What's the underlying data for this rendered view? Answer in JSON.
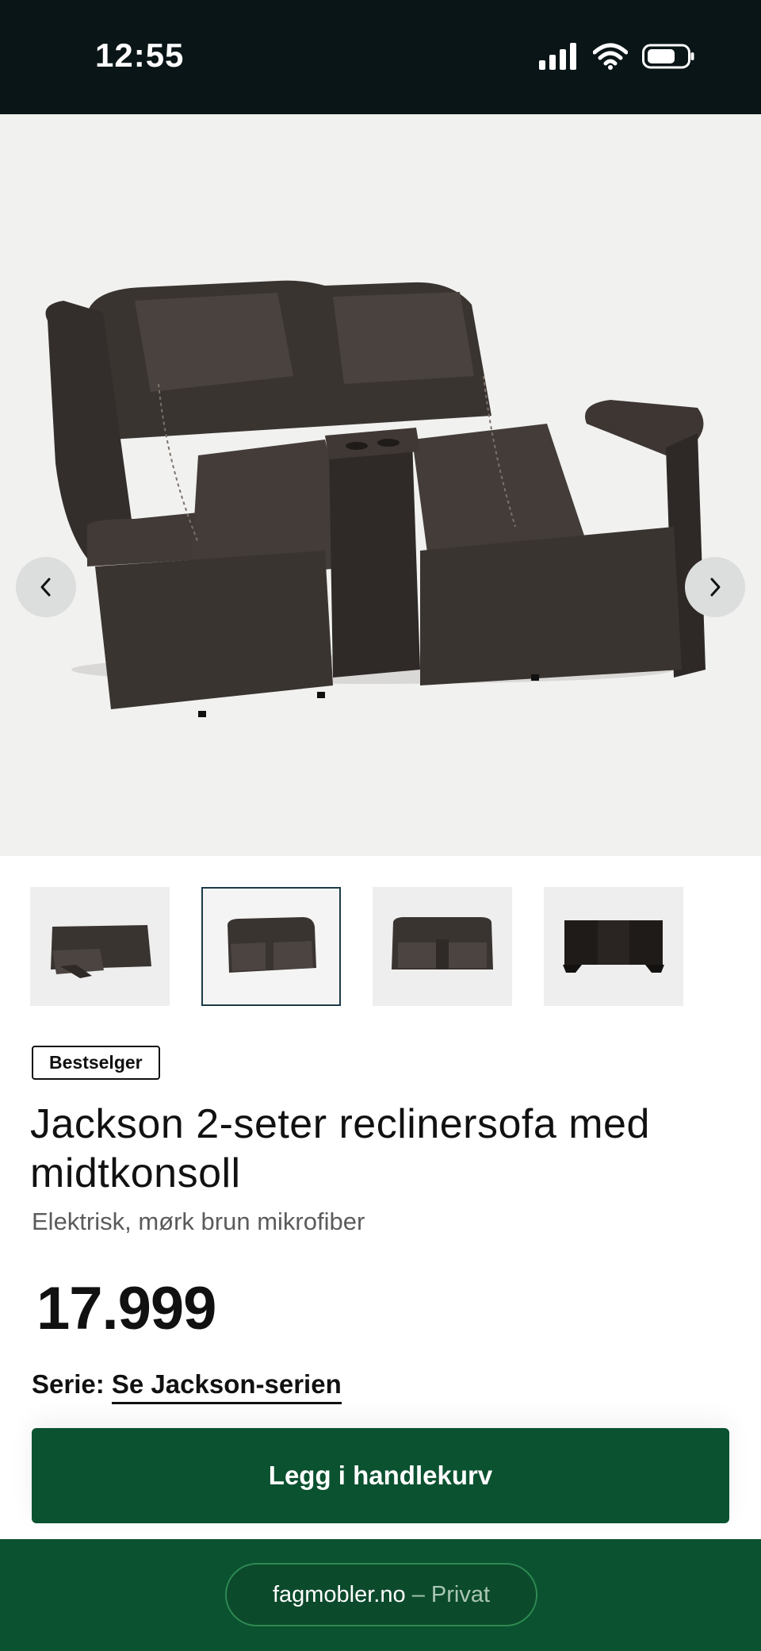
{
  "status_bar": {
    "time": "12:55"
  },
  "gallery": {
    "prev_icon": "chevron-left-icon",
    "next_icon": "chevron-right-icon",
    "thumbnails": [
      {
        "active": false
      },
      {
        "active": true
      },
      {
        "active": false
      },
      {
        "active": false
      }
    ]
  },
  "product": {
    "badge": "Bestselger",
    "title": "Jackson 2-seter reclinersofa med midtkonsoll",
    "subtitle": "Elektrisk, mørk brun mikrofiber",
    "price": "17.999",
    "serie_label": "Serie:",
    "serie_link": "Se Jackson-serien"
  },
  "actions": {
    "add_to_cart": "Legg i handlekurv"
  },
  "footer": {
    "site": "fagmobler.no",
    "separator": "–",
    "mode": "Privat"
  },
  "colors": {
    "brand_green": "#0b5230",
    "status_bar": "#0a1517",
    "thumb_active_border": "#1d3a47"
  }
}
